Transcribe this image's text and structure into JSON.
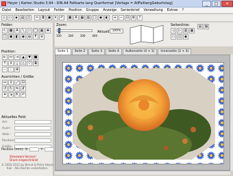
{
  "window": {
    "title": "Heyer | Karten Studio 3.94 - DIN A4 Faltkarte lang Querformat [Vorlage = AllFaltlangGeburtstag]",
    "min": "_",
    "max": "□",
    "close": "×"
  },
  "menu": [
    "Datei",
    "Bearbeiten",
    "Layout",
    "Felder",
    "Position",
    "Gruppe",
    "Anzeige",
    "Serienbrief",
    "Verwaltung",
    "Extras",
    "?"
  ],
  "left": {
    "felder_label": "Felder:",
    "position_label": "Position:",
    "ausrichten_label": "Ausrichten / Größe:",
    "aktuelles_feld_label": "Aktuelles Feld:",
    "fields": [
      {
        "label": "Art:"
      },
      {
        "label": "Ausri:"
      },
      {
        "label": "Abst.:"
      },
      {
        "label": "Position:"
      },
      {
        "label": "Größe:"
      }
    ],
    "position_mm_label": "Position (mm):",
    "x_label": "X:",
    "y_label": "Y:",
    "status_line1": "Shareware-Version!",
    "status_line2": "Druck eingeschränkt",
    "copyright1": "© 2003-2012 by Bernd & Petra Heyer,",
    "copyright2": "Kiel - Alle Rechte vorbehalten."
  },
  "top": {
    "zoom_label": "Zoom:",
    "aktuell_label": "Aktuell:",
    "zoom_value": "100%",
    "ticks": [
      "100",
      "200",
      "300",
      "400"
    ],
    "seitenlinie_label": "Seitenlinie:"
  },
  "tabs": [
    "Seite 1",
    "Seite 2",
    "Seite 3",
    "Seite 4",
    "Außenseite (4 + 1)",
    "Innenseite (2 + 3)"
  ],
  "colors": {
    "pattern": "#3c62c9",
    "rose": "#f4a23a"
  }
}
